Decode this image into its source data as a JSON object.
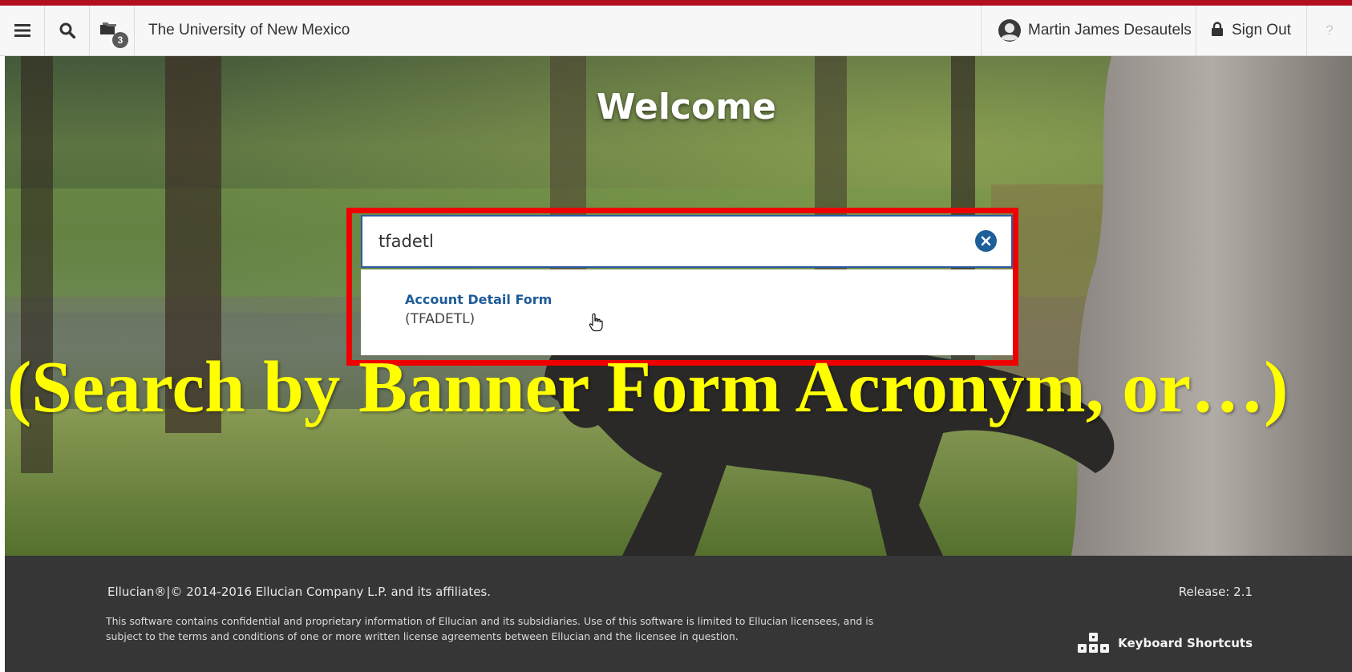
{
  "header": {
    "institution_name": "The University of New Mexico",
    "recent_items_count": "3",
    "user_name": "Martin James Desautels",
    "signout_label": "Sign Out",
    "help_label": "?",
    "icons": {
      "menu": "hamburger-icon",
      "search": "search-icon",
      "recent": "folders-icon",
      "user": "user-avatar-icon",
      "signout": "lock-icon"
    }
  },
  "hero": {
    "welcome_text": "Welcome",
    "search": {
      "value": "tfadetl",
      "clear_icon": "close-circle-icon"
    },
    "results": [
      {
        "title": "Account Detail Form",
        "code": "(TFADETL)"
      }
    ],
    "caption": "(Search by Banner Form Acronym, or…)"
  },
  "footer": {
    "copyright": "Ellucian®|© 2014-2016 Ellucian Company L.P. and its affiliates.",
    "legal": "This software contains confidential and proprietary information of Ellucian and its subsidiaries. Use of this software is limited to Ellucian licensees, and is subject to the terms and conditions of one or more written license agreements between Ellucian and the licensee in question.",
    "release": "Release: 2.1",
    "keyboard_shortcuts": "Keyboard Shortcuts"
  },
  "colors": {
    "accent_bar": "#b30f1e",
    "highlight": "#ee0000",
    "caption": "#ffff00",
    "link": "#1d5c99",
    "footer_bg": "#363636"
  }
}
